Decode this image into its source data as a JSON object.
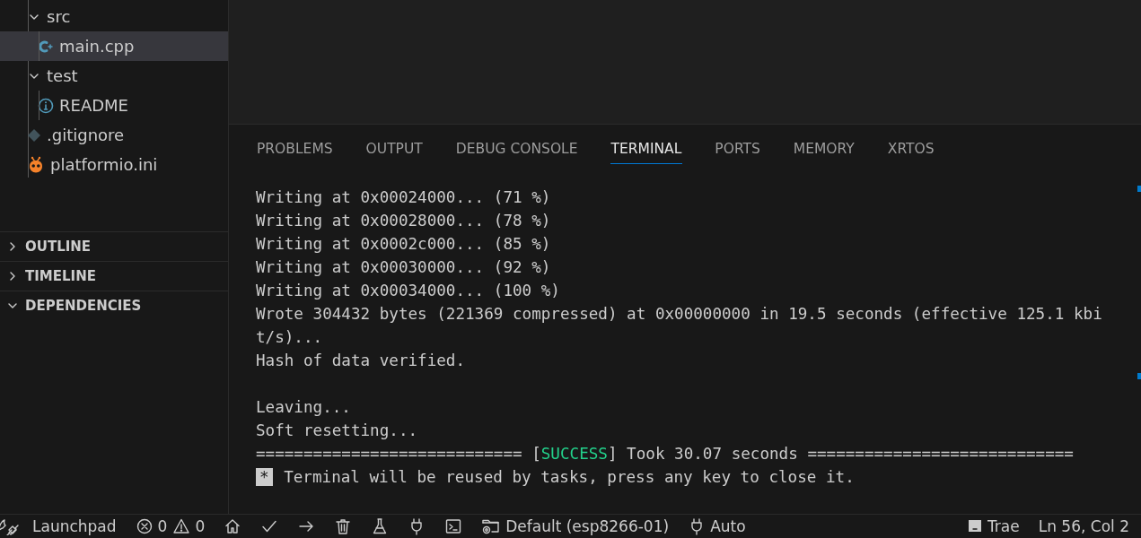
{
  "explorer": {
    "tree": [
      {
        "label": "src",
        "kind": "folder",
        "expanded": true,
        "selected": false,
        "children": [
          {
            "label": "main.cpp",
            "kind": "cpp",
            "selected": true
          }
        ]
      },
      {
        "label": "test",
        "kind": "folder",
        "expanded": true,
        "selected": false,
        "children": [
          {
            "label": "README",
            "kind": "info",
            "selected": false
          }
        ]
      },
      {
        "label": ".gitignore",
        "kind": "git",
        "selected": false
      },
      {
        "label": "platformio.ini",
        "kind": "pio",
        "selected": false
      }
    ],
    "sections": [
      {
        "label": "OUTLINE",
        "expanded": false
      },
      {
        "label": "TIMELINE",
        "expanded": false
      },
      {
        "label": "DEPENDENCIES",
        "expanded": true
      }
    ]
  },
  "panel": {
    "tabs": [
      {
        "label": "PROBLEMS",
        "selected": false
      },
      {
        "label": "OUTPUT",
        "selected": false
      },
      {
        "label": "DEBUG CONSOLE",
        "selected": false
      },
      {
        "label": "TERMINAL",
        "selected": true
      },
      {
        "label": "PORTS",
        "selected": false
      },
      {
        "label": "MEMORY",
        "selected": false
      },
      {
        "label": "XRTOS",
        "selected": false
      }
    ],
    "terminal_lines": [
      [
        {
          "kind": "plain",
          "text": "Writing at 0x00024000... (71 %)"
        }
      ],
      [
        {
          "kind": "plain",
          "text": "Writing at 0x00028000... (78 %)"
        }
      ],
      [
        {
          "kind": "plain",
          "text": "Writing at 0x0002c000... (85 %)"
        }
      ],
      [
        {
          "kind": "plain",
          "text": "Writing at 0x00030000... (92 %)"
        }
      ],
      [
        {
          "kind": "plain",
          "text": "Writing at 0x00034000... (100 %)"
        }
      ],
      [
        {
          "kind": "plain",
          "text": "Wrote 304432 bytes (221369 compressed) at 0x00000000 in 19.5 seconds (effective 125.1 kbit/s)..."
        }
      ],
      [
        {
          "kind": "plain",
          "text": "Hash of data verified."
        }
      ],
      [
        {
          "kind": "blank_line"
        },
        {
          "kind": "plain",
          "text": "Leaving..."
        }
      ],
      [
        {
          "kind": "plain",
          "text": "Soft resetting..."
        }
      ],
      [
        {
          "kind": "plain",
          "text": "============================ ["
        },
        {
          "kind": "success",
          "text": "SUCCESS"
        },
        {
          "kind": "plain",
          "text": "] Took 30.07 seconds ============================"
        }
      ],
      [
        {
          "kind": "badge",
          "text": "*"
        },
        {
          "kind": "plain",
          "text": " Terminal will be reused by tasks, press any key to close it."
        }
      ]
    ]
  },
  "status_bar": {
    "left": [
      {
        "kind": "rocket",
        "text": "Launchpad"
      },
      {
        "kind": "error",
        "text": "0"
      },
      {
        "kind": "warning",
        "text": "0"
      },
      {
        "kind": "home"
      },
      {
        "kind": "check"
      },
      {
        "kind": "arrow"
      },
      {
        "kind": "trash"
      },
      {
        "kind": "flask"
      },
      {
        "kind": "plug"
      },
      {
        "kind": "terminal"
      },
      {
        "kind": "folder",
        "text": "Default (esp8266-01)"
      },
      {
        "kind": "plug",
        "text": "Auto"
      }
    ],
    "right": [
      {
        "kind": "window",
        "text": "Trae"
      },
      {
        "text": "Ln 56, Col 2"
      }
    ]
  }
}
